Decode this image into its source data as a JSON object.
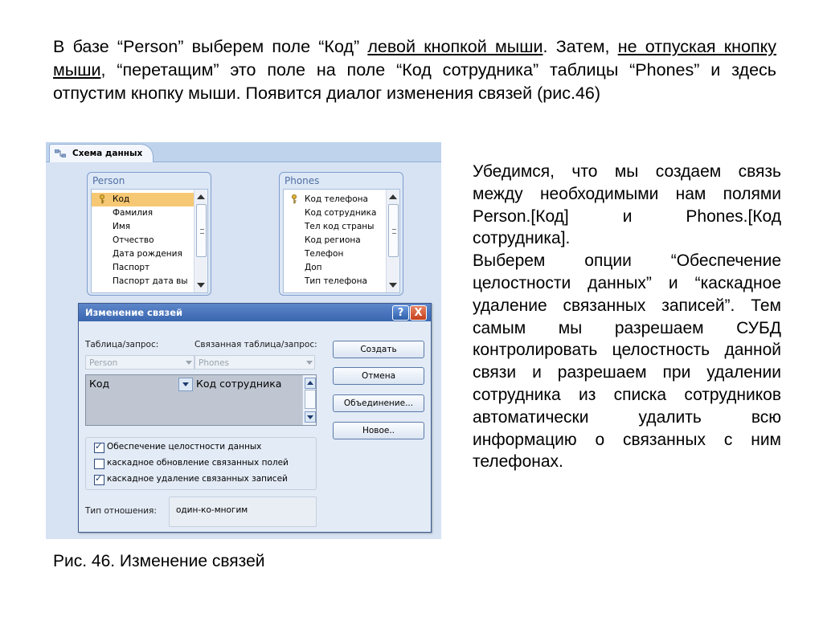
{
  "intro": {
    "s1": "В базе “Person”  выберем поле “Код” ",
    "s2": "левой кнопкой мыши",
    "s3": ". Затем, ",
    "s4": "не отпуская кнопку мыши",
    "s5": ", “перетащим” это поле на поле “Код сотрудника” таблицы “Phones” и здесь отпустим кнопку мыши.  Появится диалог изменения связей (рис.46)"
  },
  "right_text": {
    "p1": "Убедимся, что мы создаем связь между необходимыми нам полями Person.[Код] и Phones.[Код сотрудника].",
    "p2": "Выберем опции “Обеспечение целостности данных” и “каскадное удаление связанных записей”. Тем самым мы разрешаем СУБД контролировать целостность данной связи  и разрешаем при удалении сотрудника из списка сотрудников автоматически удалить всю информацию о связанных с ним телефонах."
  },
  "caption": "Рис. 46. Изменение связей",
  "screenshot": {
    "tab_label": "Схема данных",
    "person": {
      "title": "Person",
      "fields": [
        "Код",
        "Фамилия",
        "Имя",
        "Отчество",
        "Дата рождения",
        "Паспорт",
        "Паспорт дата вы"
      ]
    },
    "phones": {
      "title": "Phones",
      "fields": [
        "Код телефона",
        "Код сотрудника",
        "Тел код страны",
        "Код региона",
        "Телефон",
        "Доп",
        "Тип телефона"
      ]
    },
    "dialog": {
      "title": "Изменение связей",
      "help": "?",
      "close": "X",
      "table_label": "Таблица/запрос:",
      "related_label": "Связанная таблица/запрос:",
      "table_value": "Person",
      "related_value": "Phones",
      "grid_left": "Код",
      "grid_right": "Код сотрудника",
      "opt1": "Обеспечение целостности данных",
      "opt2": "каскадное обновление связанных полей",
      "opt3": "каскадное удаление связанных записей",
      "rel_type_label": "Тип отношения:",
      "rel_type_value": "один-ко-многим",
      "btn_create": "Создать",
      "btn_cancel": "Отмена",
      "btn_join": "Объединение...",
      "btn_new": "Новое.."
    }
  },
  "colors": {
    "accent_selection": "#f7c873",
    "dialog_title": "#3966b0"
  }
}
